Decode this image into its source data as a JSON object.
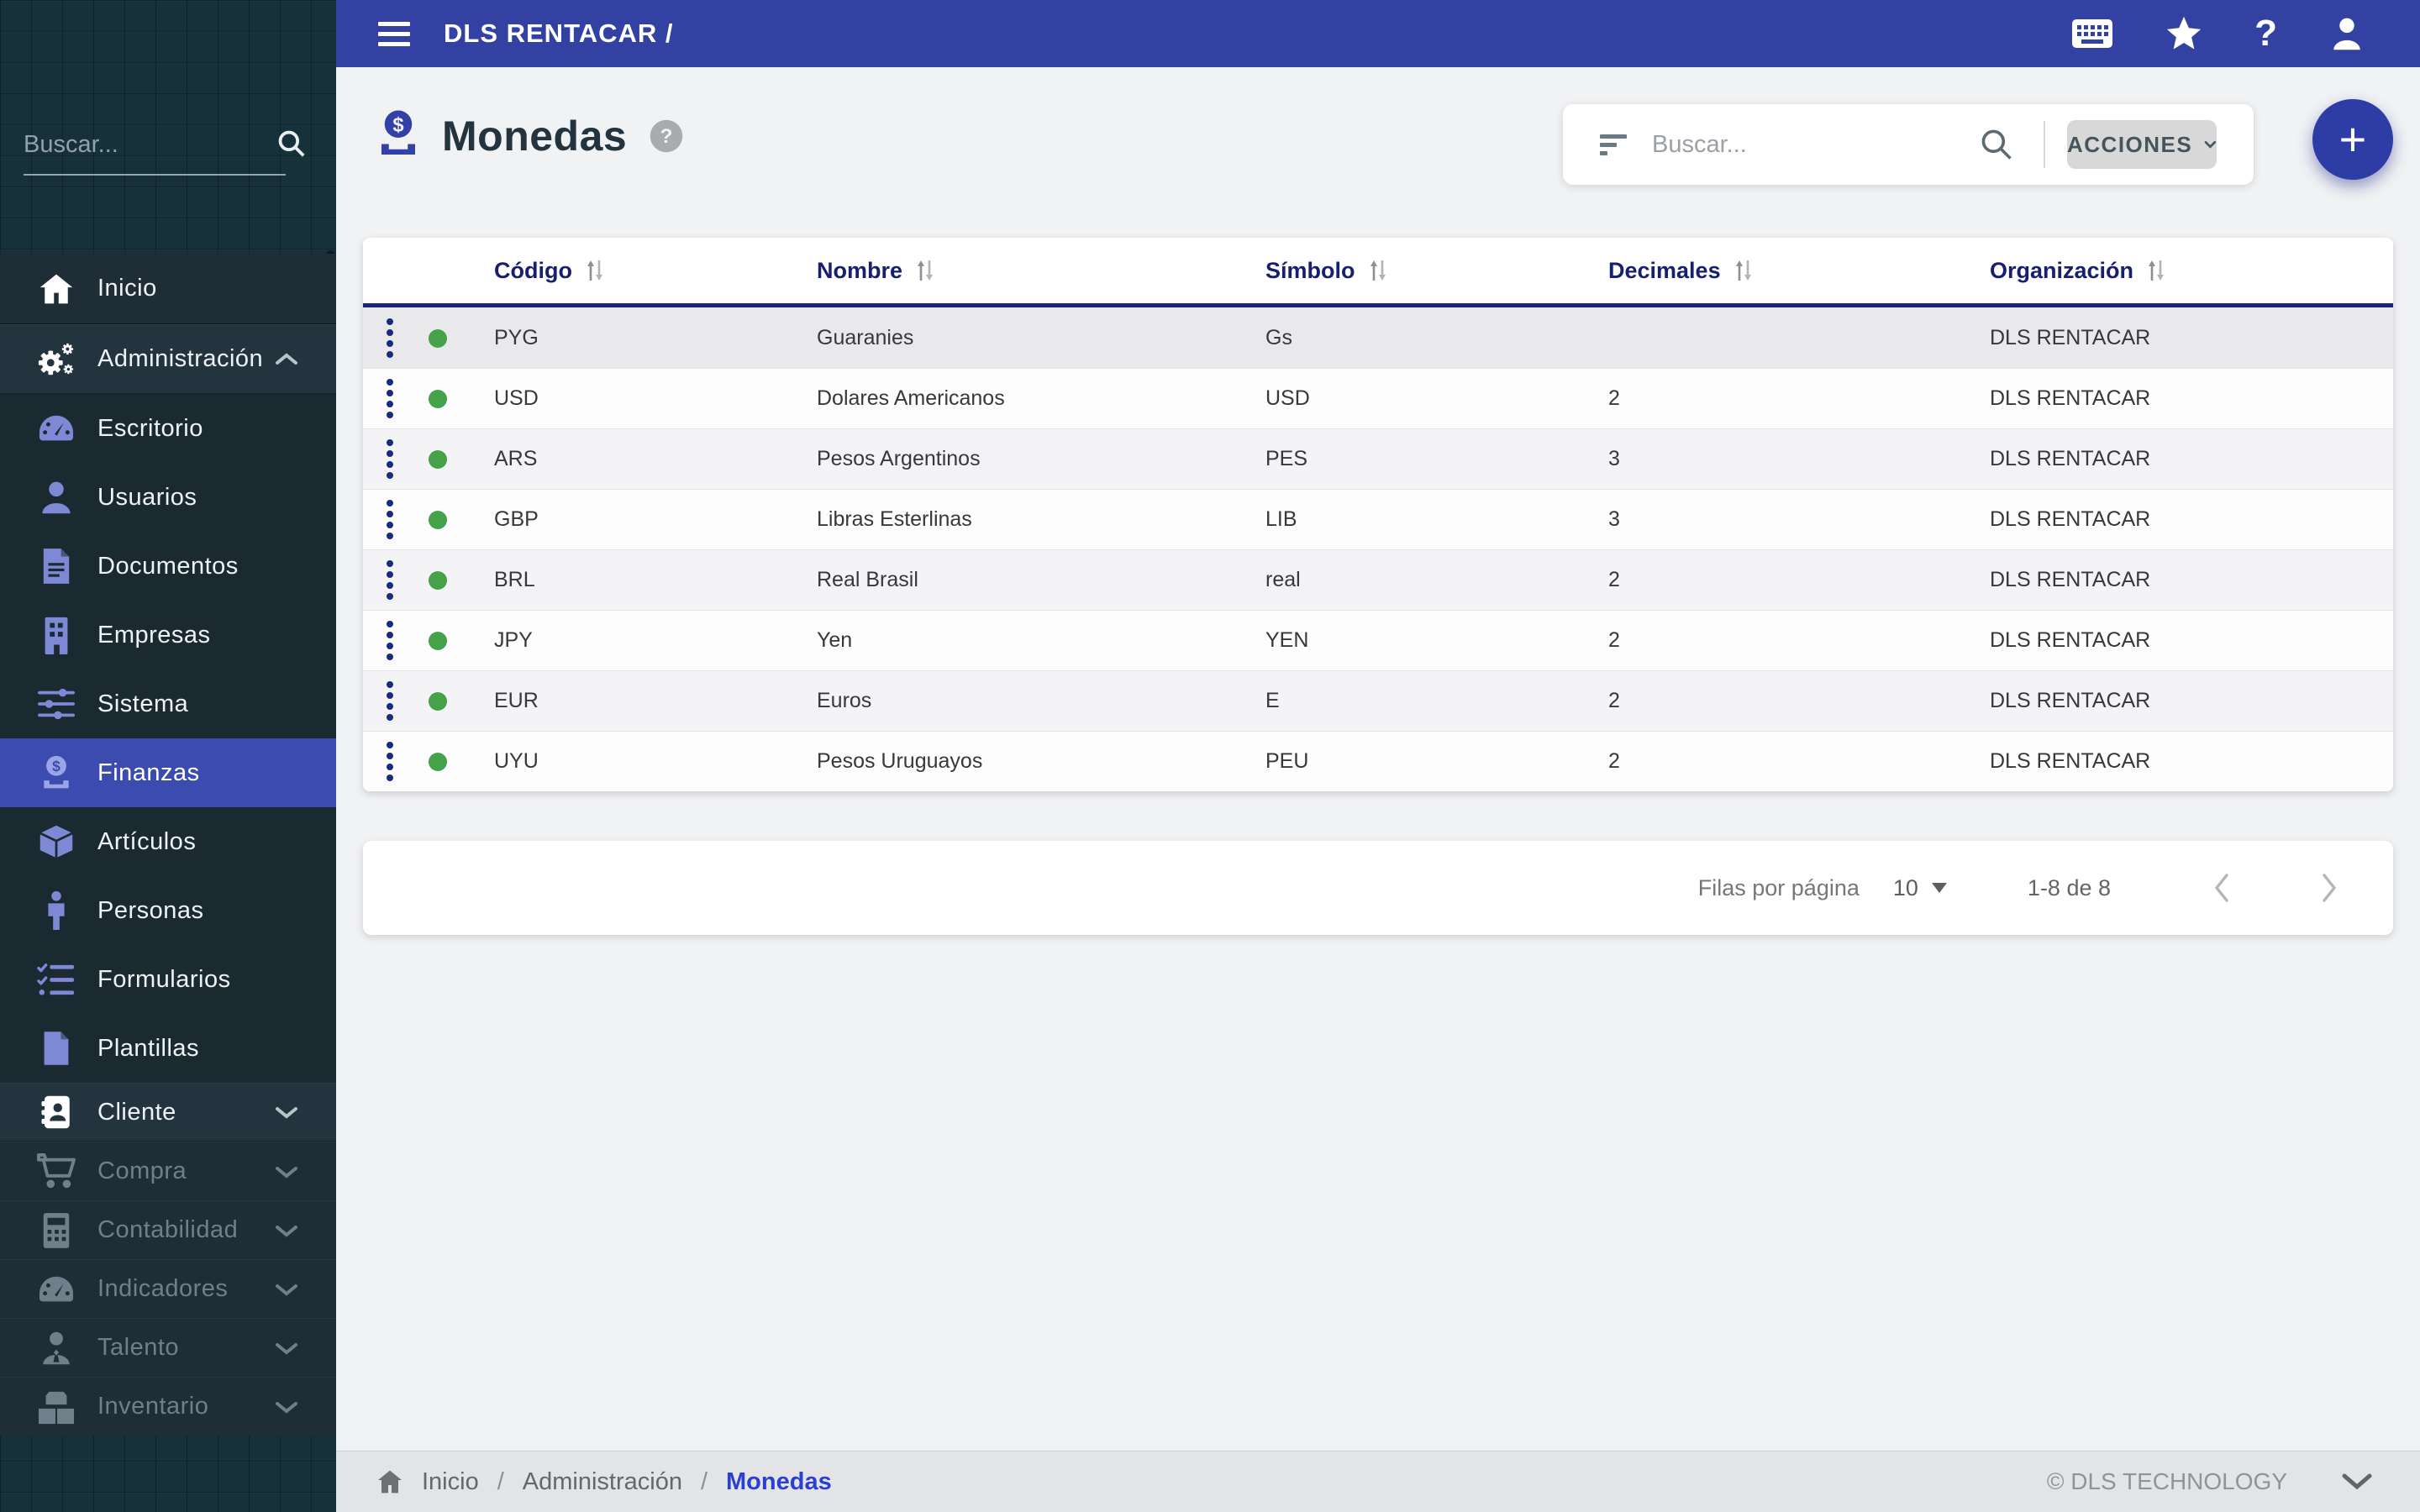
{
  "topbar": {
    "title": "DLS RENTACAR /"
  },
  "sidebar": {
    "search_placeholder": "Buscar...",
    "items": [
      {
        "label": "Inicio"
      },
      {
        "label": "Administración"
      },
      {
        "label": "Escritorio"
      },
      {
        "label": "Usuarios"
      },
      {
        "label": "Documentos"
      },
      {
        "label": "Empresas"
      },
      {
        "label": "Sistema"
      },
      {
        "label": "Finanzas"
      },
      {
        "label": "Artículos"
      },
      {
        "label": "Personas"
      },
      {
        "label": "Formularios"
      },
      {
        "label": "Plantillas"
      },
      {
        "label": "Cliente"
      },
      {
        "label": "Compra"
      },
      {
        "label": "Contabilidad"
      },
      {
        "label": "Indicadores"
      },
      {
        "label": "Talento"
      },
      {
        "label": "Inventario"
      }
    ]
  },
  "page": {
    "title": "Monedas"
  },
  "toolbar": {
    "search_placeholder": "Buscar...",
    "actions_label": "ACCIONES",
    "fab_label": "+"
  },
  "table": {
    "columns": [
      "Código",
      "Nombre",
      "Símbolo",
      "Decimales",
      "Organización"
    ],
    "rows": [
      {
        "codigo": "PYG",
        "nombre": "Guaranies",
        "simbolo": "Gs",
        "decimales": "",
        "organizacion": "DLS RENTACAR"
      },
      {
        "codigo": "USD",
        "nombre": "Dolares Americanos",
        "simbolo": "USD",
        "decimales": "2",
        "organizacion": "DLS RENTACAR"
      },
      {
        "codigo": "ARS",
        "nombre": "Pesos Argentinos",
        "simbolo": "PES",
        "decimales": "3",
        "organizacion": "DLS RENTACAR"
      },
      {
        "codigo": "GBP",
        "nombre": "Libras Esterlinas",
        "simbolo": "LIB",
        "decimales": "3",
        "organizacion": "DLS RENTACAR"
      },
      {
        "codigo": "BRL",
        "nombre": "Real Brasil",
        "simbolo": "real",
        "decimales": "2",
        "organizacion": "DLS RENTACAR"
      },
      {
        "codigo": "JPY",
        "nombre": "Yen",
        "simbolo": "YEN",
        "decimales": "2",
        "organizacion": "DLS RENTACAR"
      },
      {
        "codigo": "EUR",
        "nombre": "Euros",
        "simbolo": "E",
        "decimales": "2",
        "organizacion": "DLS RENTACAR"
      },
      {
        "codigo": "UYU",
        "nombre": "Pesos Uruguayos",
        "simbolo": "PEU",
        "decimales": "2",
        "organizacion": "DLS RENTACAR"
      }
    ]
  },
  "pagination": {
    "rows_per_page_label": "Filas por página",
    "rows_per_page": "10",
    "range": "1-8 de 8"
  },
  "footer": {
    "breadcrumb": [
      "Inicio",
      "Administración",
      "Monedas"
    ],
    "separator": "/",
    "copyright": "© DLS TECHNOLOGY"
  },
  "colors": {
    "topbar_blue": "#3341a2",
    "active_item": "#3c4bb0",
    "icon_periwinkle": "#7e89d6",
    "status_green": "#44a248",
    "header_navy": "#16206e",
    "fab_blue": "#2e3ca6",
    "breadcrumb_blue": "#2b3fd0"
  }
}
